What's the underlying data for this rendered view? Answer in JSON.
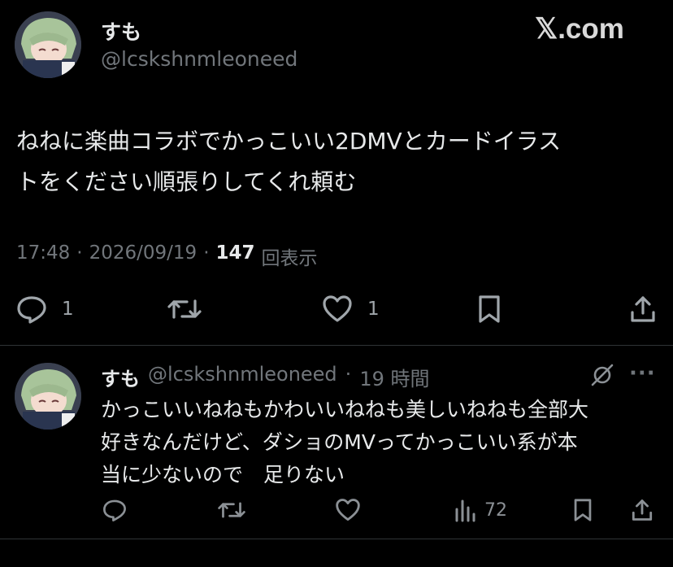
{
  "main_tweet": {
    "display_name": "すも",
    "handle": "@lcskshnmleoneed",
    "watermark": "𝕏.com",
    "text_line1": "ねねに楽曲コラボでかっこいい2DMVとカードイラス",
    "text_line2": "トをください順張りしてくれ頼む",
    "time": "17:48",
    "date": "2026/09/19",
    "separator": "·",
    "views_count": "147",
    "views_label": "回表示",
    "reply_count": "1",
    "like_count": "1"
  },
  "reply_tweet": {
    "display_name": "すも",
    "handle": "@lcskshnmleoneed",
    "separator": "·",
    "time_ago": "19 時間",
    "text_line1": "かっこいいねねもかわいいねねも美しいねねも全部大",
    "text_line2": "好きなんだけど、ダショのMVってかっこいい系が本",
    "text_line3": "当に少ないので　足りない",
    "more_label": "···",
    "views_count": "72"
  },
  "colors": {
    "background": "#000000",
    "text": "#e7e9ea",
    "muted": "#71767b",
    "divider": "#2f3336"
  },
  "icons": [
    "reply-icon",
    "retweet-icon",
    "like-icon",
    "bookmark-icon",
    "share-icon",
    "grok-icon",
    "more-icon",
    "views-icon"
  ]
}
